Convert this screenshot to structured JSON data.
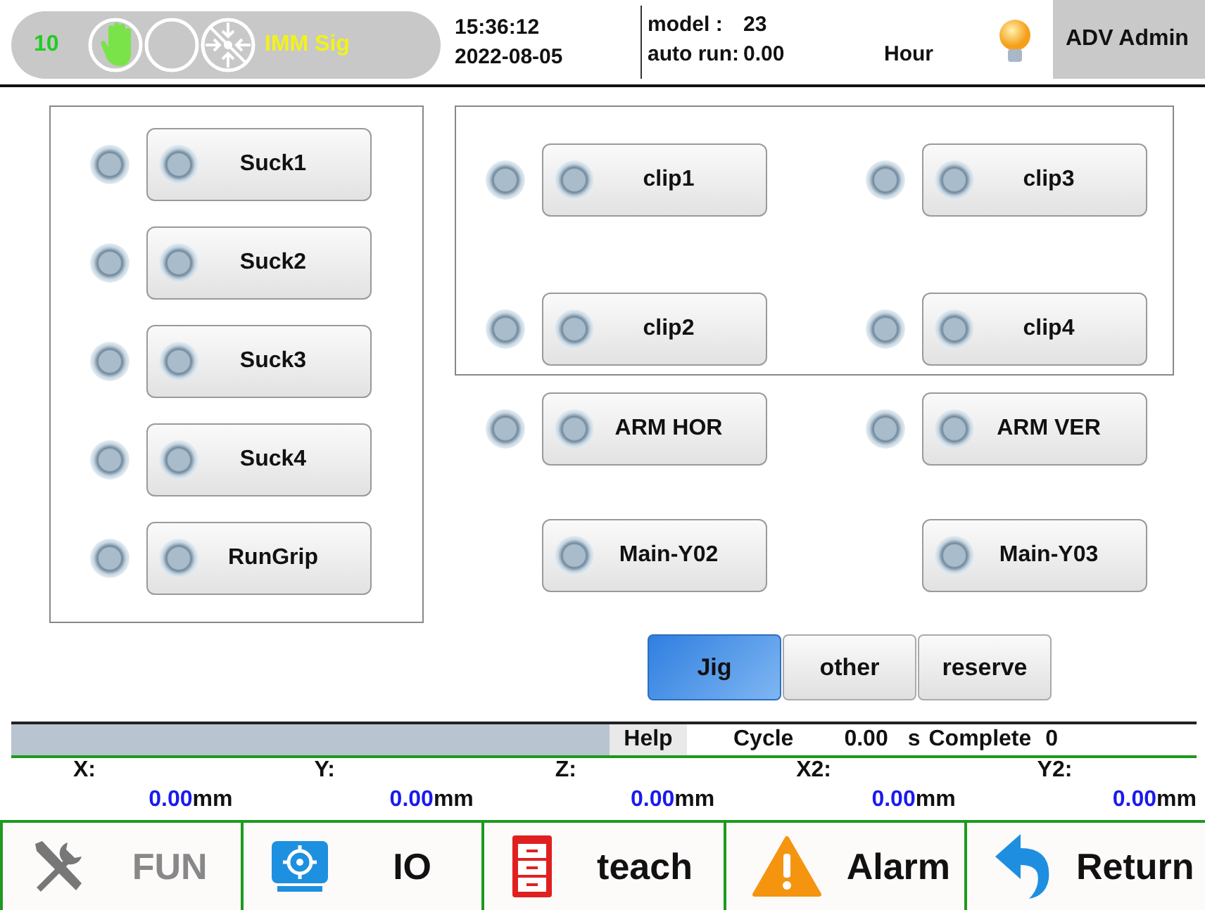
{
  "header": {
    "count": "10",
    "indicators": [
      {
        "kind": "hand",
        "on": true
      },
      {
        "kind": "blank",
        "on": false
      },
      {
        "kind": "clamp",
        "on": false
      }
    ],
    "signal_label": "IMM Sig",
    "time": "15:36:12",
    "date": "2022-08-05",
    "model_label": "model :",
    "model_value": "23",
    "auto_run_label": "auto run:",
    "auto_run_value": "0.00",
    "auto_run_unit": "Hour",
    "lamp_on": true,
    "user": "ADV Admin"
  },
  "grip_outputs": [
    {
      "label": "Suck1",
      "kind": "with_feedback",
      "on": false,
      "feedback_on": false
    },
    {
      "label": "Suck2",
      "kind": "with_feedback",
      "on": false,
      "feedback_on": false
    },
    {
      "label": "Suck3",
      "kind": "with_feedback",
      "on": false,
      "feedback_on": false
    },
    {
      "label": "Suck4",
      "kind": "with_feedback",
      "on": false,
      "feedback_on": false
    },
    {
      "label": "RunGrip",
      "kind": "with_feedback",
      "on": false,
      "feedback_on": false
    }
  ],
  "clip_outputs": [
    {
      "label": "clip1",
      "kind": "with_feedback",
      "on": false,
      "feedback_on": false
    },
    {
      "label": "clip3",
      "kind": "with_feedback",
      "on": false,
      "feedback_on": false
    },
    {
      "label": "clip2",
      "kind": "with_feedback",
      "on": false,
      "feedback_on": false
    },
    {
      "label": "clip4",
      "kind": "with_feedback",
      "on": false,
      "feedback_on": false
    }
  ],
  "arm_outputs": [
    {
      "label": "ARM HOR",
      "kind": "with_feedback",
      "on": false,
      "feedback_on": false
    },
    {
      "label": "ARM VER",
      "kind": "with_feedback",
      "on": false,
      "feedback_on": false
    },
    {
      "label": "Main-Y02",
      "kind": "output_only",
      "on": false
    },
    {
      "label": "Main-Y03",
      "kind": "output_only",
      "on": false
    }
  ],
  "tabs": [
    {
      "label": "Jig",
      "selected": true
    },
    {
      "label": "other",
      "selected": false
    },
    {
      "label": "reserve",
      "selected": false
    }
  ],
  "status_bar": {
    "help": "Help",
    "cycle_label": "Cycle",
    "cycle_value": "0.00",
    "cycle_unit": "s",
    "complete_label": "Complete",
    "complete_value": "0"
  },
  "coordinates": [
    {
      "axis": "X:",
      "value": "0.00",
      "unit": "mm"
    },
    {
      "axis": "Y:",
      "value": "0.00",
      "unit": "mm"
    },
    {
      "axis": "Z:",
      "value": "0.00",
      "unit": "mm"
    },
    {
      "axis": "X2:",
      "value": "0.00",
      "unit": "mm"
    },
    {
      "axis": "Y2:",
      "value": "0.00",
      "unit": "mm"
    }
  ],
  "nav": [
    {
      "kind": "fun",
      "label": "FUN",
      "disabled": true
    },
    {
      "kind": "io",
      "label": "IO",
      "disabled": false
    },
    {
      "kind": "teach",
      "label": "teach",
      "disabled": false
    },
    {
      "kind": "alarm",
      "label": "Alarm",
      "disabled": false
    },
    {
      "kind": "return",
      "label": "Return",
      "disabled": false
    }
  ]
}
